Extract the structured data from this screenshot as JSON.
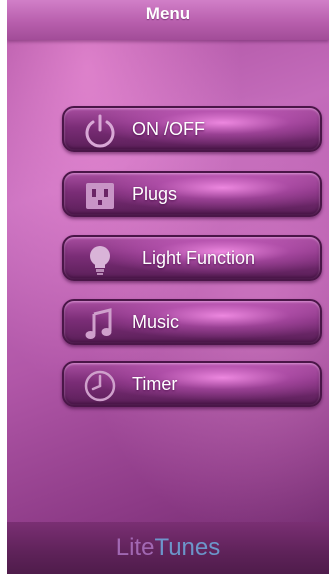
{
  "header": {
    "title": "Menu"
  },
  "menu": {
    "items": [
      {
        "label": "ON /OFF",
        "icon": "power-icon"
      },
      {
        "label": "Plugs",
        "icon": "plug-outlet-icon"
      },
      {
        "label": "Light Function",
        "icon": "light-bulb-icon"
      },
      {
        "label": "Music",
        "icon": "music-note-icon"
      },
      {
        "label": "Timer",
        "icon": "clock-icon"
      }
    ]
  },
  "footer": {
    "logo_part1": "Lite",
    "logo_part2": "Tunes"
  },
  "colors": {
    "background": "#b157a8",
    "header": "#b85fad",
    "button": "#7b2d77",
    "logo_lite": "#b77fd0",
    "logo_tunes": "#6fb2e6"
  }
}
